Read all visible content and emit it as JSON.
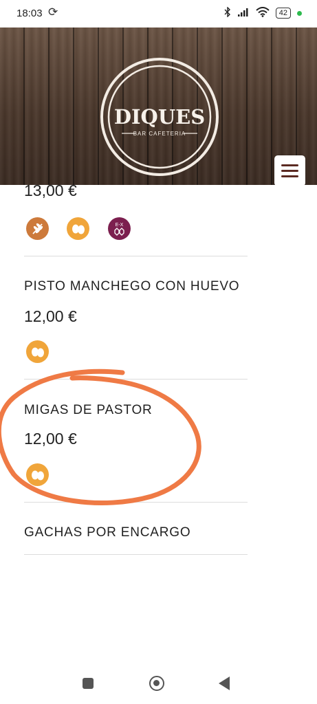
{
  "status_bar": {
    "time": "18:03",
    "sync_icon": "sync-icon",
    "icons": [
      "bluetooth-icon",
      "signal-icon",
      "wifi-icon"
    ],
    "battery": "42"
  },
  "header": {
    "logo": {
      "brand": "DIQUES",
      "tagline": "BAR  CAFETERIA"
    },
    "menu_icon": "hamburger-icon"
  },
  "menu": {
    "items": [
      {
        "name": "",
        "price": "13,00 €",
        "allergens": [
          "gluten",
          "egg",
          "sulfites"
        ]
      },
      {
        "name": "PISTO MANCHEGO CON HUEVO",
        "price": "12,00 €",
        "allergens": [
          "egg"
        ]
      },
      {
        "name": "MIGAS DE PASTOR",
        "price": "12,00 €",
        "allergens": [
          "egg"
        ]
      },
      {
        "name": "GACHAS POR ENCARGO",
        "price": "",
        "allergens": []
      }
    ]
  },
  "annotation": {
    "color": "#ef7a45"
  },
  "nav_bar": {
    "icons": [
      "recents-icon",
      "home-icon",
      "back-icon"
    ]
  }
}
